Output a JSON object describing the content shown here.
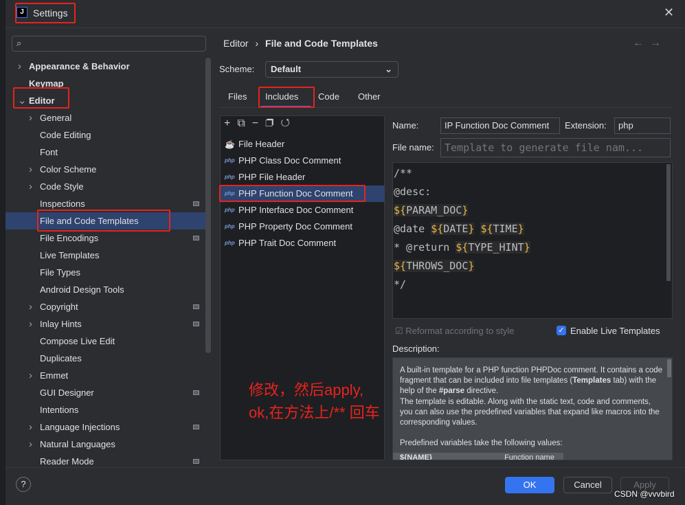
{
  "window": {
    "title": "Settings",
    "close_icon": "close-icon",
    "app_icon": "intellij-icon"
  },
  "search": {
    "placeholder": "",
    "icon": "search-icon"
  },
  "sidebar": {
    "items": [
      {
        "label": "Appearance & Behavior",
        "level": 0,
        "chevron": "right"
      },
      {
        "label": "Keymap",
        "level": 0
      },
      {
        "label": "Editor",
        "level": 0,
        "chevron": "down"
      },
      {
        "label": "General",
        "level": 1,
        "chevron": "right"
      },
      {
        "label": "Code Editing",
        "level": 1
      },
      {
        "label": "Font",
        "level": 1
      },
      {
        "label": "Color Scheme",
        "level": 1,
        "chevron": "right"
      },
      {
        "label": "Code Style",
        "level": 1,
        "chevron": "right"
      },
      {
        "label": "Inspections",
        "level": 1,
        "modified": true
      },
      {
        "label": "File and Code Templates",
        "level": 1,
        "selected": true
      },
      {
        "label": "File Encodings",
        "level": 1,
        "modified": true
      },
      {
        "label": "Live Templates",
        "level": 1
      },
      {
        "label": "File Types",
        "level": 1
      },
      {
        "label": "Android Design Tools",
        "level": 1
      },
      {
        "label": "Copyright",
        "level": 1,
        "chevron": "right",
        "modified": true
      },
      {
        "label": "Inlay Hints",
        "level": 1,
        "chevron": "right",
        "modified": true
      },
      {
        "label": "Compose Live Edit",
        "level": 1
      },
      {
        "label": "Duplicates",
        "level": 1
      },
      {
        "label": "Emmet",
        "level": 1,
        "chevron": "right"
      },
      {
        "label": "GUI Designer",
        "level": 1,
        "modified": true
      },
      {
        "label": "Intentions",
        "level": 1
      },
      {
        "label": "Language Injections",
        "level": 1,
        "chevron": "right",
        "modified": true
      },
      {
        "label": "Natural Languages",
        "level": 1,
        "chevron": "right"
      },
      {
        "label": "Reader Mode",
        "level": 1,
        "modified": true
      }
    ]
  },
  "breadcrumb": {
    "parent": "Editor",
    "sep": "›",
    "current": "File and Code Templates"
  },
  "scheme": {
    "label": "Scheme:",
    "value": "Default"
  },
  "tabs": [
    {
      "label": "Files"
    },
    {
      "label": "Includes",
      "active": true
    },
    {
      "label": "Code"
    },
    {
      "label": "Other"
    }
  ],
  "templates": [
    {
      "label": "File Header",
      "icon": "coffee-icon"
    },
    {
      "label": "PHP Class Doc Comment",
      "icon": "php-icon"
    },
    {
      "label": "PHP File Header",
      "icon": "php-icon"
    },
    {
      "label": "PHP Function Doc Comment",
      "icon": "php-icon",
      "selected": true
    },
    {
      "label": "PHP Interface Doc Comment",
      "icon": "php-icon"
    },
    {
      "label": "PHP Property Doc Comment",
      "icon": "php-icon"
    },
    {
      "label": "PHP Trait Doc Comment",
      "icon": "php-icon"
    }
  ],
  "php_badge": "php",
  "form": {
    "name_label": "Name:",
    "name_value": "IP Function Doc Comment",
    "ext_label": "Extension:",
    "ext_value": "php",
    "filename_label": "File name:",
    "filename_placeholder": "Template to generate file nam..."
  },
  "code_lines": [
    "/**",
    "@desc:",
    "${PARAM_DOC}",
    "@date ${DATE} ${TIME}",
    "* @return ${TYPE_HINT}",
    "${THROWS_DOC}",
    "*/"
  ],
  "options": {
    "reformat": "Reformat according to style",
    "reformat_checked": true,
    "reformat_disabled": true,
    "live": "Enable Live Templates",
    "live_checked": true
  },
  "description": {
    "label": "Description:",
    "p1a": "A built-in template for a PHP function PHPDoc comment. It contains a code fragment that can be included into file templates (",
    "b1": "Templates",
    "p1b": " tab) with the help of the ",
    "b2": "#parse",
    "p1c": " directive.",
    "p2": "The template is editable. Along with the static text, code and comments, you can also use the predefined variables that expand like macros into the corresponding values.",
    "p3": "Predefined variables take the following values:",
    "row_var": "${NAME}",
    "row_desc": "Function name"
  },
  "buttons": {
    "ok": "OK",
    "cancel": "Cancel",
    "apply": "Apply",
    "help": "?"
  },
  "annotation": {
    "line1": "修改，然后apply,",
    "line2": "ok,在方法上/** 回车",
    "color": "#e8231f"
  },
  "watermark": "CSDN @vvvbird",
  "colors": {
    "accent": "#3574f0",
    "selection": "#2e436e",
    "annotation": "#e8231f"
  }
}
